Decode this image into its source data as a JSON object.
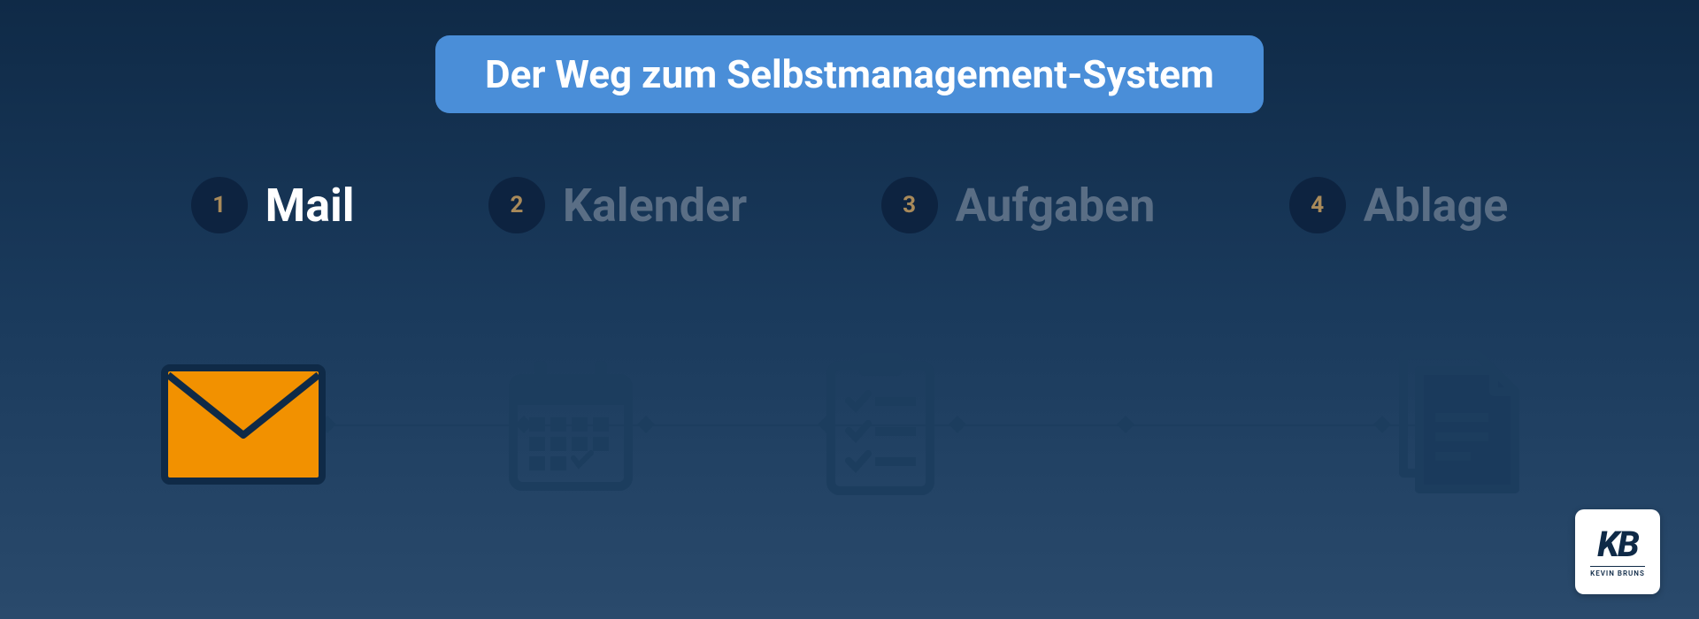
{
  "title": "Der Weg zum Selbstmanagement-System",
  "steps": [
    {
      "num": "1",
      "label": "Mail",
      "icon": "mail-icon",
      "active": true
    },
    {
      "num": "2",
      "label": "Kalender",
      "icon": "calendar-icon",
      "active": false
    },
    {
      "num": "3",
      "label": "Aufgaben",
      "icon": "clipboard-icon",
      "active": false
    },
    {
      "num": "4",
      "label": "Ablage",
      "icon": "document-icon",
      "active": false
    }
  ],
  "logo": {
    "mark": "KB",
    "sub": "KEVIN BRUNS"
  },
  "colors": {
    "accent_active": "#f29100",
    "accent_muted": "#1c3d5e",
    "badge_bg": "#4a8ed8",
    "step_num_color": "#a98a5a"
  }
}
